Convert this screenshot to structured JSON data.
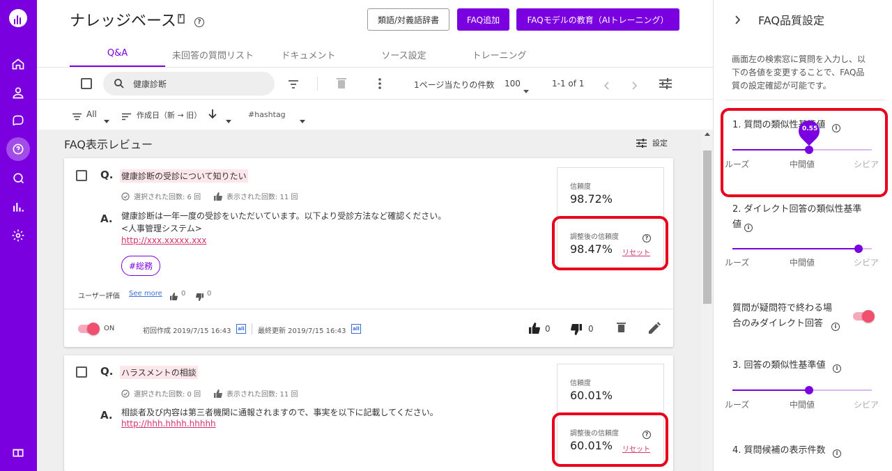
{
  "header": {
    "title": "ナレッジベース",
    "buttons": {
      "synonym": "類語/対義語辞書",
      "add_faq": "FAQ追加",
      "train": "FAQモデルの教育（AIトレーニング）"
    }
  },
  "tabs": [
    {
      "label": "Q&A",
      "active": true
    },
    {
      "label": "未回答の質問リスト"
    },
    {
      "label": "ドキュメント"
    },
    {
      "label": "ソース設定"
    },
    {
      "label": "トレーニング"
    }
  ],
  "toolbar": {
    "search_value": "健康診断",
    "per_page_label": "1ページ当たりの件数",
    "per_page_value": "100",
    "range": "1-1 of 1"
  },
  "filters": {
    "all": "All",
    "sort": "作成日（新 → 旧）",
    "hashtag": "#hashtag"
  },
  "review": {
    "title": "FAQ表示レビュー",
    "settings_label": "設定"
  },
  "cards": [
    {
      "q_label": "Q.",
      "question": "健康診断の受診について知りたい",
      "selected": "選択された回数: 6 回",
      "shown": "表示された回数: 11 回",
      "a_label": "A.",
      "answer_lines": [
        "健康診断は一年一度の受診をいただいています。以下より受診方法など確認ください。",
        "<人事管理システム>"
      ],
      "link": "http://xxx.xxxxx.xxx",
      "tag": "#総務",
      "confidence_label": "信頼度",
      "confidence": "98.72%",
      "adjusted_label": "調整後の信頼度",
      "adjusted": "98.47%",
      "reset": "リセット",
      "user_rating_label": "ユーザー評価",
      "see_more": "See more",
      "rating_up": "0",
      "rating_down": "0",
      "toggle_label": "ON",
      "created": "初回作成 2019/7/15 16:43",
      "updated": "最終更新 2019/7/15 16:43",
      "all_badge": "all",
      "likes": "0",
      "dislikes": "0"
    },
    {
      "q_label": "Q.",
      "question": "ハラスメントの相談",
      "selected": "選択された回数: 0 回",
      "shown": "表示された回数: 11 回",
      "a_label": "A.",
      "answer_lines": [
        "相談者及び内容は第三者機関に通報されますので、事実を以下に記載してください。"
      ],
      "link": "http://hhh.hhhh.hhhhh",
      "confidence_label": "信頼度",
      "confidence": "60.01%",
      "adjusted_label": "調整後の信頼度",
      "adjusted": "60.01%",
      "reset": "リセット"
    }
  ],
  "panel": {
    "title": "FAQ品質設定",
    "description": [
      "画面左の検索窓に質問を入力し、以",
      "下の各値を変更することで、FAQ品",
      "質の設定確認が可能です。"
    ],
    "sliders": [
      {
        "title": "1. 質問の類似性基準値",
        "value": "0.55",
        "position": 0.55
      },
      {
        "title_lines": [
          "2. ダイレクト回答の類似性基準",
          "値"
        ],
        "position": 0.9
      },
      {
        "title": "3. 回答の類似性基準値",
        "position": 0.55
      }
    ],
    "slider_labels": {
      "loose": "ルーズ",
      "mid": "中間値",
      "severe": "シビア"
    },
    "toggle_text": [
      "質問が疑問符で終わる場",
      "合のみダイレクト回答"
    ],
    "item4": "4. 質問候補の表示件数"
  }
}
